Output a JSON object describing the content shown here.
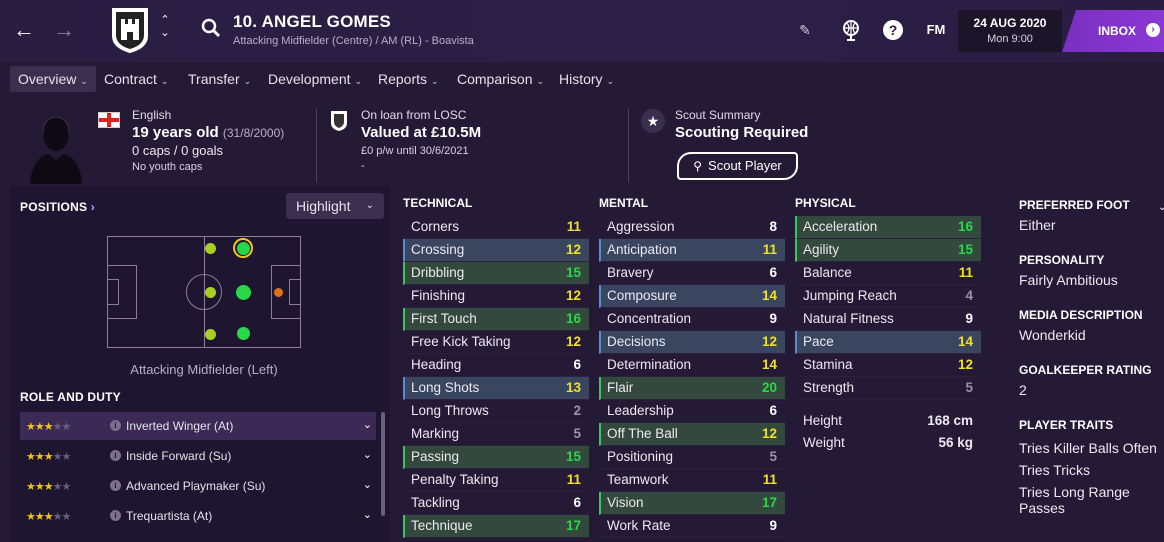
{
  "header": {
    "player_name": "10. ANGEL GOMES",
    "player_sub": "Attacking Midfielder (Centre) / AM (RL) - Boavista",
    "fm_logo": "FM",
    "date": "24 AUG 2020",
    "day_time": "Mon 9:00",
    "inbox_label": "INBOX",
    "accent": "#8b38d6"
  },
  "tabs": [
    {
      "label": "Overview"
    },
    {
      "label": "Contract"
    },
    {
      "label": "Transfer"
    },
    {
      "label": "Development"
    },
    {
      "label": "Reports"
    },
    {
      "label": "Comparison"
    },
    {
      "label": "History"
    }
  ],
  "info": {
    "nationality": "English",
    "age_main": "19 years old",
    "age_dob": "(31/8/2000)",
    "caps": "0 caps / 0 goals",
    "youth_caps": "No youth caps",
    "loan_from": "On loan from LOSC",
    "value": "Valued at £10.5M",
    "wage": "£0 p/w until 30/6/2021",
    "dash": "-",
    "scout_summary_label": "Scout Summary",
    "scout_summary_value": "Scouting Required",
    "scout_button": "Scout Player"
  },
  "positions": {
    "title": "POSITIONS",
    "highlight": "Highlight",
    "caption": "Attacking Midfielder (Left)"
  },
  "roles": {
    "title": "ROLE AND DUTY",
    "items": [
      {
        "label": "Inverted Winger (At)",
        "stars": "2.5"
      },
      {
        "label": "Inside Forward (Su)",
        "stars": "2.5"
      },
      {
        "label": "Advanced Playmaker (Su)",
        "stars": "2.5"
      },
      {
        "label": "Trequartista (At)",
        "stars": "2.5"
      }
    ]
  },
  "technical": {
    "title": "TECHNICAL",
    "items": [
      {
        "label": "Corners",
        "value": "11"
      },
      {
        "label": "Crossing",
        "value": "12"
      },
      {
        "label": "Dribbling",
        "value": "15"
      },
      {
        "label": "Finishing",
        "value": "12"
      },
      {
        "label": "First Touch",
        "value": "16"
      },
      {
        "label": "Free Kick Taking",
        "value": "12"
      },
      {
        "label": "Heading",
        "value": "6"
      },
      {
        "label": "Long Shots",
        "value": "13"
      },
      {
        "label": "Long Throws",
        "value": "2"
      },
      {
        "label": "Marking",
        "value": "5"
      },
      {
        "label": "Passing",
        "value": "15"
      },
      {
        "label": "Penalty Taking",
        "value": "11"
      },
      {
        "label": "Tackling",
        "value": "6"
      },
      {
        "label": "Technique",
        "value": "17"
      }
    ]
  },
  "mental": {
    "title": "MENTAL",
    "items": [
      {
        "label": "Aggression",
        "value": "8"
      },
      {
        "label": "Anticipation",
        "value": "11"
      },
      {
        "label": "Bravery",
        "value": "6"
      },
      {
        "label": "Composure",
        "value": "14"
      },
      {
        "label": "Concentration",
        "value": "9"
      },
      {
        "label": "Decisions",
        "value": "12"
      },
      {
        "label": "Determination",
        "value": "14"
      },
      {
        "label": "Flair",
        "value": "20"
      },
      {
        "label": "Leadership",
        "value": "6"
      },
      {
        "label": "Off The Ball",
        "value": "12"
      },
      {
        "label": "Positioning",
        "value": "5"
      },
      {
        "label": "Teamwork",
        "value": "11"
      },
      {
        "label": "Vision",
        "value": "17"
      },
      {
        "label": "Work Rate",
        "value": "9"
      }
    ]
  },
  "physical": {
    "title": "PHYSICAL",
    "items": [
      {
        "label": "Acceleration",
        "value": "16"
      },
      {
        "label": "Agility",
        "value": "15"
      },
      {
        "label": "Balance",
        "value": "11"
      },
      {
        "label": "Jumping Reach",
        "value": "4"
      },
      {
        "label": "Natural Fitness",
        "value": "9"
      },
      {
        "label": "Pace",
        "value": "14"
      },
      {
        "label": "Stamina",
        "value": "12"
      },
      {
        "label": "Strength",
        "value": "5"
      }
    ],
    "height_label": "Height",
    "height_value": "168 cm",
    "weight_label": "Weight",
    "weight_value": "56 kg"
  },
  "profile": {
    "preferred_foot_label": "PREFERRED FOOT",
    "preferred_foot_value": "Either",
    "personality_label": "PERSONALITY",
    "personality_value": "Fairly Ambitious",
    "media_label": "MEDIA DESCRIPTION",
    "media_value": "Wonderkid",
    "gk_label": "GOALKEEPER RATING",
    "gk_value": "2",
    "traits_label": "PLAYER TRAITS",
    "traits": [
      "Tries Killer Balls Often",
      "Tries Tricks",
      "Tries Long Range Passes"
    ]
  }
}
